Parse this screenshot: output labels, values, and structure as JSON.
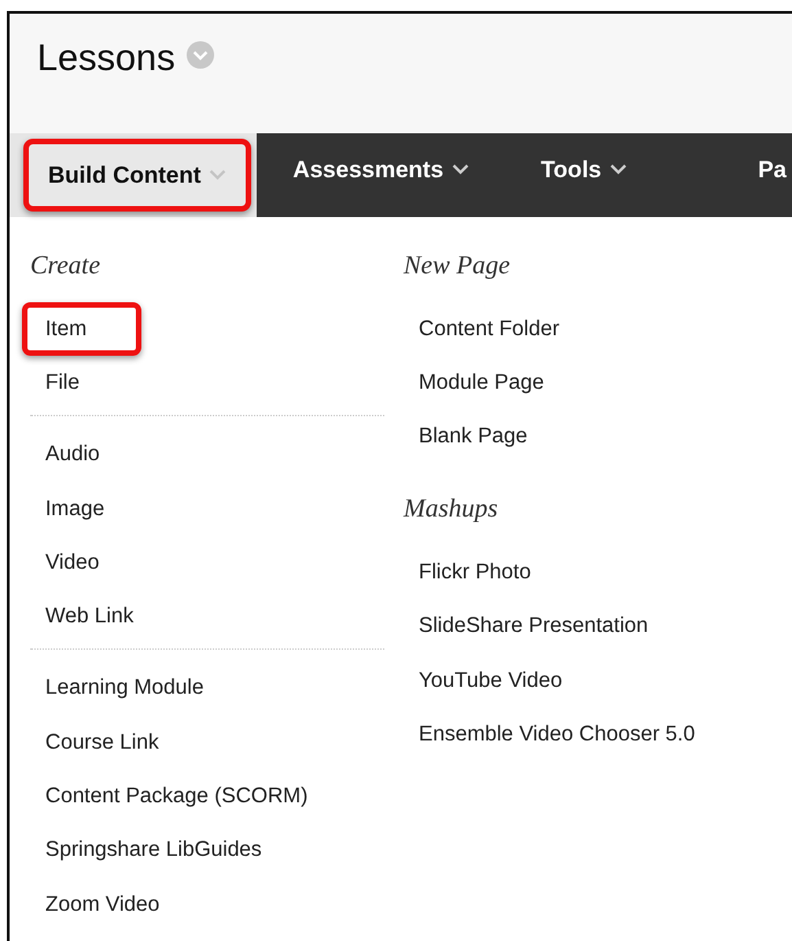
{
  "page_title": "Lessons",
  "nav": {
    "tabs": [
      {
        "label": "Build Content",
        "selected": true,
        "highlighted": true
      },
      {
        "label": "Assessments",
        "selected": false,
        "highlighted": false
      },
      {
        "label": "Tools",
        "selected": false,
        "highlighted": false
      },
      {
        "label": "Pa",
        "selected": false,
        "highlighted": false
      }
    ]
  },
  "menu": {
    "columns": [
      {
        "sections": [
          {
            "heading": "Create",
            "groups": [
              {
                "items": [
                  {
                    "label": "Item",
                    "highlighted": true
                  },
                  {
                    "label": "File",
                    "highlighted": false
                  }
                ]
              },
              {
                "items": [
                  {
                    "label": "Audio",
                    "highlighted": false
                  },
                  {
                    "label": "Image",
                    "highlighted": false
                  },
                  {
                    "label": "Video",
                    "highlighted": false
                  },
                  {
                    "label": "Web Link",
                    "highlighted": false
                  }
                ]
              },
              {
                "items": [
                  {
                    "label": "Learning Module",
                    "highlighted": false
                  },
                  {
                    "label": "Course Link",
                    "highlighted": false
                  },
                  {
                    "label": "Content Package (SCORM)",
                    "highlighted": false
                  },
                  {
                    "label": "Springshare LibGuides",
                    "highlighted": false
                  },
                  {
                    "label": "Zoom Video",
                    "highlighted": false
                  }
                ]
              }
            ]
          }
        ]
      },
      {
        "sections": [
          {
            "heading": "New Page",
            "groups": [
              {
                "items": [
                  {
                    "label": "Content Folder",
                    "highlighted": false
                  },
                  {
                    "label": "Module Page",
                    "highlighted": false
                  },
                  {
                    "label": "Blank Page",
                    "highlighted": false
                  }
                ]
              }
            ]
          },
          {
            "heading": "Mashups",
            "groups": [
              {
                "items": [
                  {
                    "label": "Flickr Photo",
                    "highlighted": false
                  },
                  {
                    "label": "SlideShare Presentation",
                    "highlighted": false
                  },
                  {
                    "label": "YouTube Video",
                    "highlighted": false
                  },
                  {
                    "label": "Ensemble Video Chooser 5.0",
                    "highlighted": false
                  }
                ]
              }
            ]
          }
        ]
      }
    ]
  }
}
